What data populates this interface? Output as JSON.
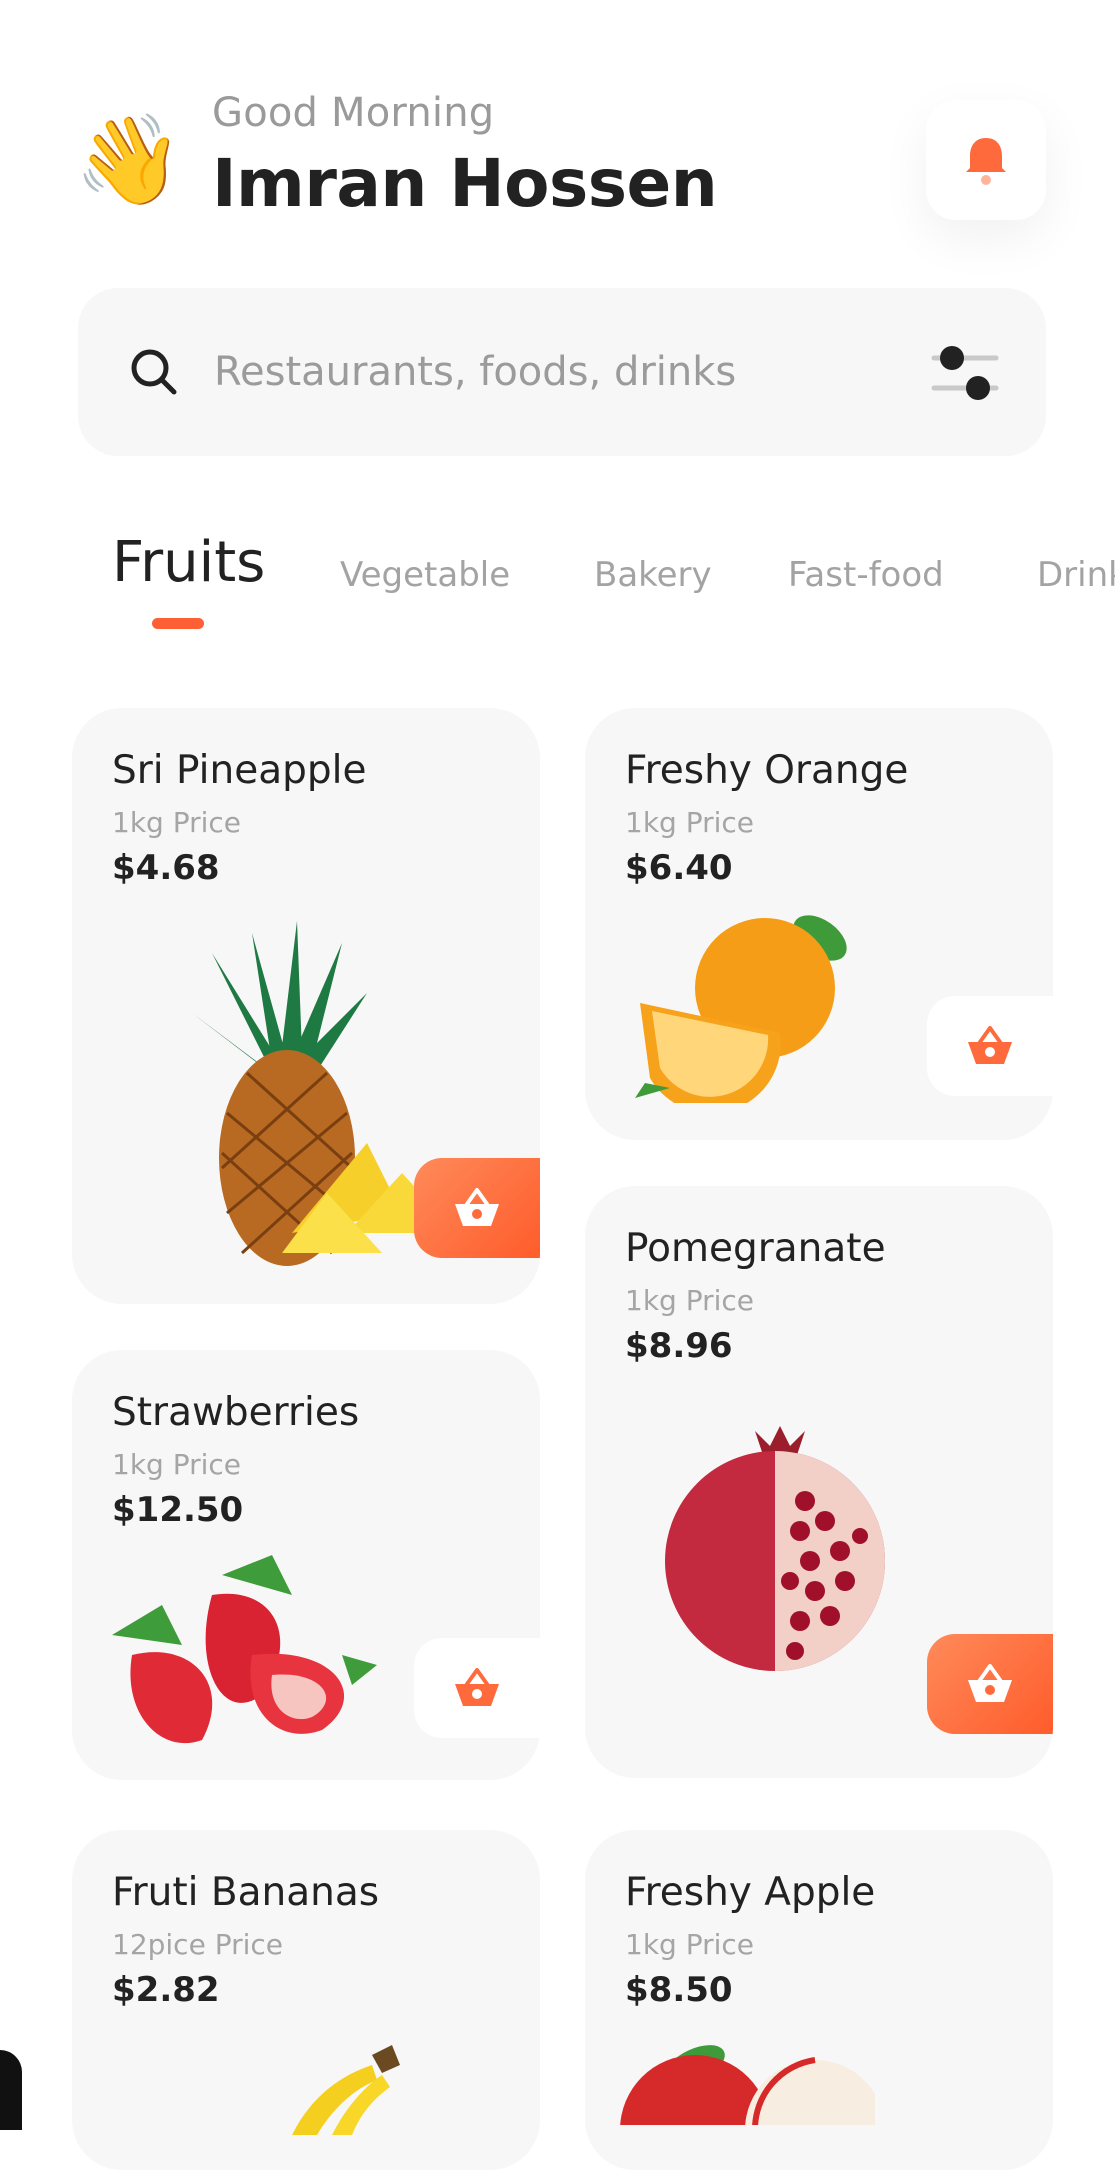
{
  "header": {
    "wave_emoji": "👋",
    "greeting": "Good Morning",
    "user_name": "Imran Hossen",
    "bell_icon": "bell-icon"
  },
  "search": {
    "placeholder": "Restaurants, foods, drinks",
    "search_icon": "search-icon",
    "filter_icon": "filter-sliders-icon"
  },
  "tabs": [
    {
      "label": "Fruits",
      "active": true
    },
    {
      "label": "Vegetable",
      "active": false
    },
    {
      "label": "Bakery",
      "active": false
    },
    {
      "label": "Fast-food",
      "active": false
    },
    {
      "label": "Drink",
      "active": false
    }
  ],
  "colors": {
    "accent": "#ff5f34",
    "card_bg": "#f7f7f7",
    "text_primary": "#222222",
    "text_secondary": "#a5a5a5"
  },
  "products": [
    {
      "name": "Sri Pineapple",
      "unit": "1kg Price",
      "price": "$4.68",
      "image": "pineapple",
      "cart_style": "orange"
    },
    {
      "name": "Freshy Orange",
      "unit": "1kg Price",
      "price": "$6.40",
      "image": "orange",
      "cart_style": "white"
    },
    {
      "name": "Pomegranate",
      "unit": "1kg Price",
      "price": "$8.96",
      "image": "pomegranate",
      "cart_style": "orange"
    },
    {
      "name": "Strawberries",
      "unit": "1kg Price",
      "price": "$12.50",
      "image": "strawberries",
      "cart_style": "white"
    },
    {
      "name": "Fruti Bananas",
      "unit": "12pice Price",
      "price": "$2.82",
      "image": "bananas"
    },
    {
      "name": "Freshy Apple",
      "unit": "1kg Price",
      "price": "$8.50",
      "image": "apple"
    }
  ]
}
